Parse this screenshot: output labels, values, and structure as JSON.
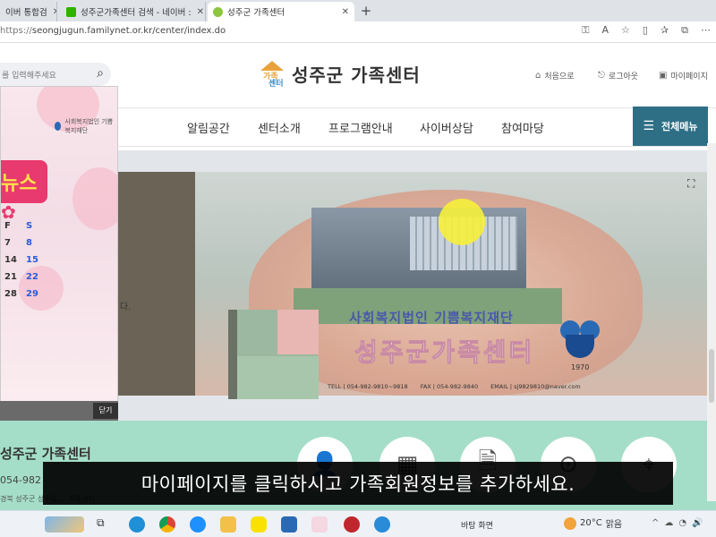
{
  "browser": {
    "tabs": [
      {
        "label": "이버 통합검"
      },
      {
        "label": "성주군가족센터 검색 - 네이버 :"
      },
      {
        "label": "성주군 가족센터"
      }
    ],
    "url_prefix": "https://",
    "url": "seongjugun.familynet.or.kr/center/index.do"
  },
  "site": {
    "logo_mark_top": "가족",
    "logo_mark_bottom": "센터",
    "logo_text": "성주군 가족센터",
    "util": {
      "home": "처음으로",
      "logout": "로그아웃",
      "mypage": "마이페이지"
    },
    "search_placeholder": "를 입력해주세요",
    "nav": [
      "알림공간",
      "센터소개",
      "프로그램안내",
      "사이버상담",
      "참여마당"
    ],
    "allmenu": "전체메뉴",
    "hero": {
      "subtitle": "사회복지법인 기쁨복지재단",
      "title": "성주군가족센터",
      "year": "1970",
      "tel": "TELL | 054-982-9810~9818",
      "fax": "FAX | 054-982-9840",
      "email": "EMAIL | sj9829810@naver.com"
    },
    "org": {
      "name": "성주군 가족센터",
      "tel": "054-982",
      "address": "경북 성주군 성주읍 ... 가족센터"
    }
  },
  "popup": {
    "logo": "사회복지법인 기쁨복지재단",
    "banner": "뉴스",
    "calendar": [
      [
        "F",
        "S"
      ],
      [
        "7",
        "8"
      ],
      [
        "14",
        "15"
      ],
      [
        "21",
        "22"
      ],
      [
        "28",
        "29"
      ]
    ],
    "side_text": "다.",
    "close": "닫기"
  },
  "subtitle": "마이페이지를 클릭하시고 가족회원정보를 추가하세요.",
  "taskbar": {
    "desktop": "바탕 화면",
    "temp": "20°C",
    "weather": "맑음"
  },
  "colors": {
    "accent": "#2f6f86",
    "mint": "#a4dec9",
    "banner": "#e83a6e"
  }
}
